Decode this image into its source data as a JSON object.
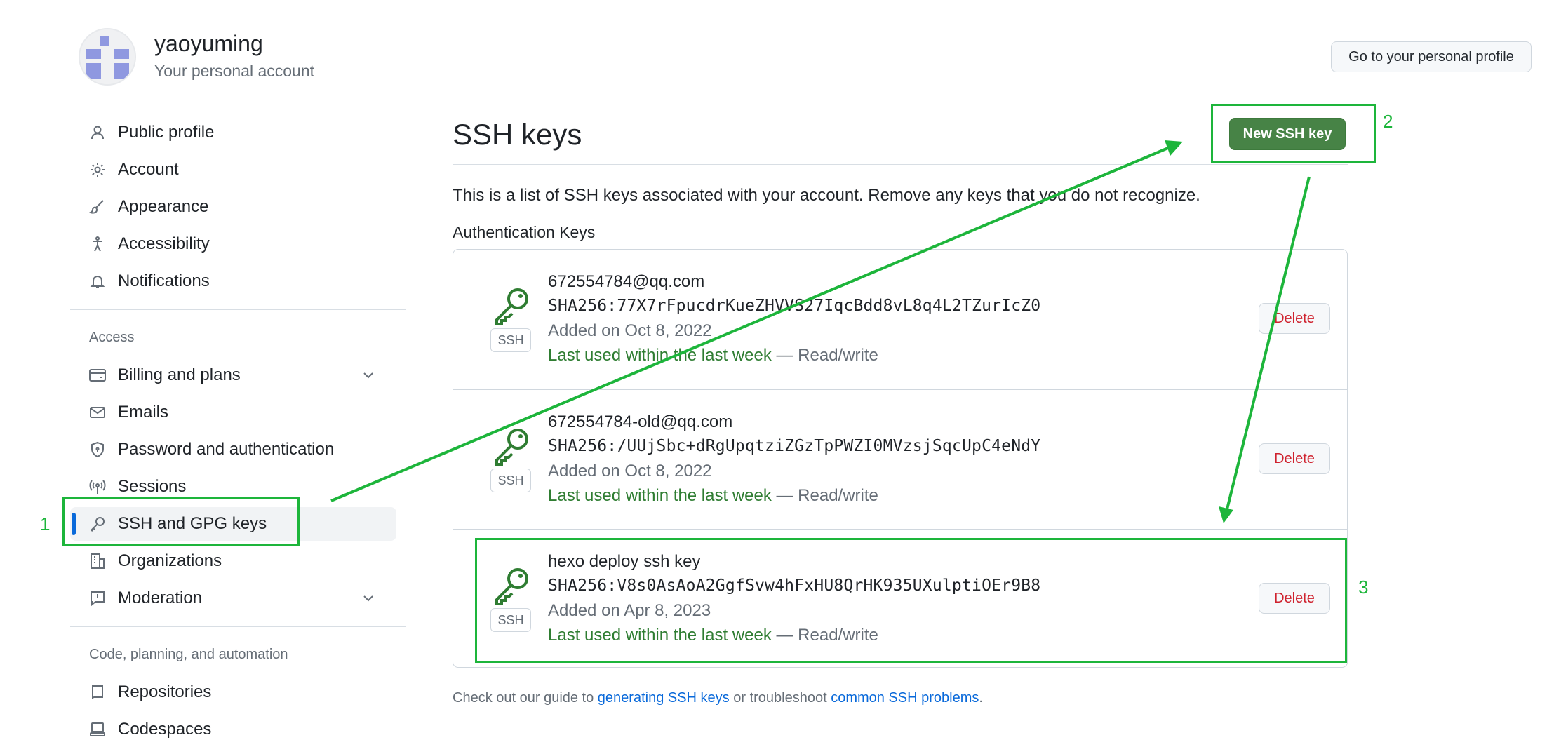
{
  "header": {
    "username": "yaoyuming",
    "subtitle": "Your personal account",
    "profile_button": "Go to your personal profile"
  },
  "sidebar": {
    "items_top": [
      {
        "label": "Public profile",
        "icon": "person-icon"
      },
      {
        "label": "Account",
        "icon": "gear-icon"
      },
      {
        "label": "Appearance",
        "icon": "paintbrush-icon"
      },
      {
        "label": "Accessibility",
        "icon": "accessibility-icon"
      },
      {
        "label": "Notifications",
        "icon": "bell-icon"
      }
    ],
    "access_heading": "Access",
    "items_access": [
      {
        "label": "Billing and plans",
        "icon": "credit-card-icon"
      },
      {
        "label": "Emails",
        "icon": "mail-icon"
      },
      {
        "label": "Password and authentication",
        "icon": "shield-lock-icon"
      },
      {
        "label": "Sessions",
        "icon": "broadcast-icon"
      },
      {
        "label": "SSH and GPG keys",
        "icon": "key-icon"
      },
      {
        "label": "Organizations",
        "icon": "organization-icon"
      },
      {
        "label": "Moderation",
        "icon": "report-icon"
      }
    ],
    "code_heading": "Code, planning, and automation",
    "items_code": [
      {
        "label": "Repositories",
        "icon": "repo-icon"
      },
      {
        "label": "Codespaces",
        "icon": "codespaces-icon"
      }
    ]
  },
  "main": {
    "title": "SSH keys",
    "new_key_button": "New SSH key",
    "intro": "This is a list of SSH keys associated with your account. Remove any keys that you do not recognize.",
    "auth_heading": "Authentication Keys",
    "keys": [
      {
        "title": "672554784@qq.com",
        "fingerprint": "SHA256:77X7rFpucdrKueZHVVS27IqcBdd8vL8q4L2TZurIcZ0",
        "added": "Added on Oct 8, 2022",
        "last_used": "Last used within the last week",
        "access": "— Read/write",
        "badge": "SSH",
        "delete_label": "Delete"
      },
      {
        "title": "672554784-old@qq.com",
        "fingerprint": "SHA256:/UUjSbc+dRgUpqtziZGzTpPWZI0MVzsjSqcUpC4eNdY",
        "added": "Added on Oct 8, 2022",
        "last_used": "Last used within the last week",
        "access": "— Read/write",
        "badge": "SSH",
        "delete_label": "Delete"
      },
      {
        "title": "hexo deploy ssh key",
        "fingerprint": "SHA256:V8s0AsAoA2GgfSvw4hFxHU8QrHK935UXulptiOEr9B8",
        "added": "Added on Apr 8, 2023",
        "last_used": "Last used within the last week",
        "access": "— Read/write",
        "badge": "SSH",
        "delete_label": "Delete"
      }
    ],
    "footer": {
      "prefix": "Check out our guide to ",
      "link1": "generating SSH keys",
      "middle": " or troubleshoot ",
      "link2": "common SSH problems",
      "suffix": "."
    }
  },
  "annotations": {
    "labels": [
      "1",
      "2",
      "3"
    ],
    "color": "#1db53b"
  },
  "colors": {
    "accent_green": "#478346",
    "link_blue": "#0969da",
    "danger_red": "#cf222e",
    "active_indicator": "#0969da"
  }
}
